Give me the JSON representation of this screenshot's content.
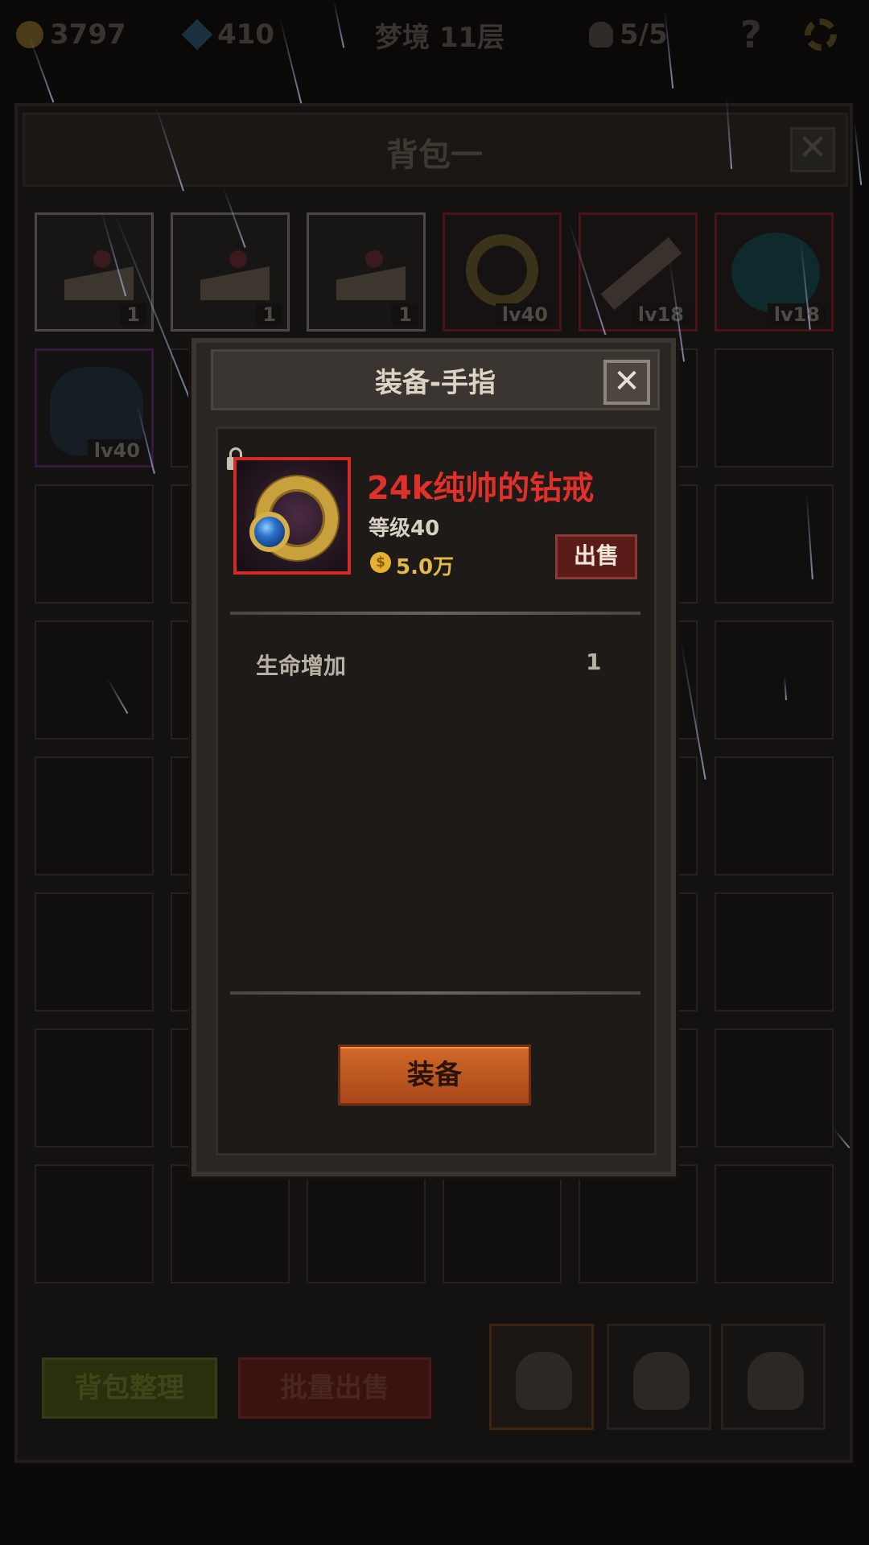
{
  "topbar": {
    "gold": "3797",
    "gems": "410",
    "stage": "梦境 11层",
    "lives": "5/5",
    "help": "?"
  },
  "backpack": {
    "title": "背包一",
    "close": "✕",
    "row1": [
      {
        "item": "cake",
        "badge": "1",
        "rarity": "white"
      },
      {
        "item": "cake",
        "badge": "1",
        "rarity": "white"
      },
      {
        "item": "cake",
        "badge": "1",
        "rarity": "white"
      },
      {
        "item": "ring",
        "badge": "lv40",
        "rarity": "red"
      },
      {
        "item": "dagger",
        "badge": "lv18",
        "rarity": "red"
      },
      {
        "item": "amulet",
        "badge": "lv18",
        "rarity": "red"
      }
    ],
    "row2_first": {
      "item": "armor",
      "badge": "lv40",
      "rarity": "purple"
    },
    "sort_button": "背包整理",
    "batch_sell_button": "批量出售"
  },
  "modal": {
    "title": "装备-手指",
    "close": "✕",
    "item_name": "24k纯帅的钻戒",
    "item_name_color": "#e0302a",
    "level": "等级40",
    "price_icon": "$",
    "price": "5.0万",
    "sell_button": "出售",
    "attributes": [
      {
        "name": "生命增加",
        "value": "1"
      }
    ],
    "equip_button": "装备"
  }
}
